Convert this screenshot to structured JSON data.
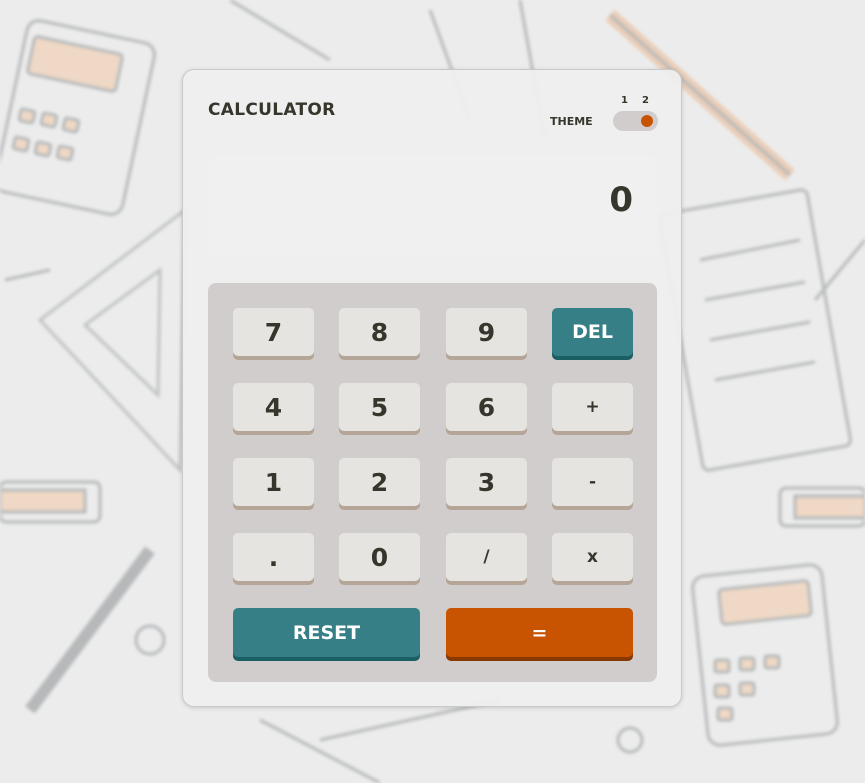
{
  "app": {
    "title": "CALCULATOR"
  },
  "theme": {
    "label": "THEME",
    "options": [
      "1",
      "2"
    ],
    "selected": "2"
  },
  "display": {
    "value": "0"
  },
  "keys": {
    "k7": "7",
    "k8": "8",
    "k9": "9",
    "del": "DEL",
    "k4": "4",
    "k5": "5",
    "k6": "6",
    "plus": "+",
    "k1": "1",
    "k2": "2",
    "k3": "3",
    "minus": "-",
    "dot": ".",
    "k0": "0",
    "divide": "/",
    "multiply": "x",
    "reset": "RESET",
    "equals": "="
  },
  "colors": {
    "accent_teal": "#377f86",
    "accent_orange": "#c85402",
    "keypad_bg": "#d2cdcd",
    "key_bg": "#e6e4e0",
    "text_dark": "#36362c"
  }
}
